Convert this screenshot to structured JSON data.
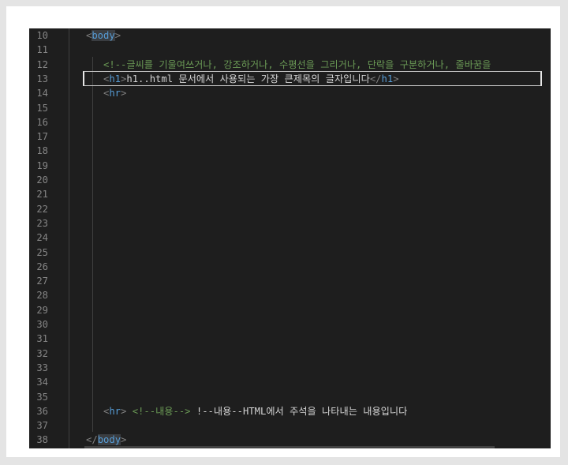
{
  "editor": {
    "lines": [
      {
        "num": "10",
        "tokens": [
          {
            "t": "<",
            "c": "punct"
          },
          {
            "t": "body",
            "c": "tag-hl"
          },
          {
            "t": ">",
            "c": "punct"
          }
        ],
        "indent": 1
      },
      {
        "num": "11",
        "tokens": [],
        "indent": 0
      },
      {
        "num": "12",
        "tokens": [
          {
            "t": "<!--글씨를 기울여쓰거나, 강조하거나, 수평선을 그리거나, 단락을 구분하거나, 줄바꿈을",
            "c": "comment"
          }
        ],
        "indent": 2
      },
      {
        "num": "13",
        "tokens": [
          {
            "t": "<",
            "c": "punct"
          },
          {
            "t": "h1",
            "c": "tag"
          },
          {
            "t": ">",
            "c": "punct"
          },
          {
            "t": "h1..html 문서에서 사용되는 가장 큰제목의 글자입니다",
            "c": "text"
          },
          {
            "t": "</",
            "c": "punct"
          },
          {
            "t": "h1",
            "c": "tag"
          },
          {
            "t": ">",
            "c": "punct"
          }
        ],
        "indent": 2,
        "current": true
      },
      {
        "num": "14",
        "tokens": [
          {
            "t": "<",
            "c": "punct"
          },
          {
            "t": "hr",
            "c": "tag"
          },
          {
            "t": ">",
            "c": "punct"
          }
        ],
        "indent": 2
      },
      {
        "num": "15",
        "tokens": [],
        "indent": 0
      },
      {
        "num": "16",
        "tokens": [],
        "indent": 0
      },
      {
        "num": "17",
        "tokens": [],
        "indent": 0
      },
      {
        "num": "18",
        "tokens": [],
        "indent": 0
      },
      {
        "num": "19",
        "tokens": [],
        "indent": 0
      },
      {
        "num": "20",
        "tokens": [],
        "indent": 0
      },
      {
        "num": "21",
        "tokens": [],
        "indent": 0
      },
      {
        "num": "22",
        "tokens": [],
        "indent": 0
      },
      {
        "num": "23",
        "tokens": [],
        "indent": 0
      },
      {
        "num": "24",
        "tokens": [],
        "indent": 0
      },
      {
        "num": "25",
        "tokens": [],
        "indent": 0
      },
      {
        "num": "26",
        "tokens": [],
        "indent": 0
      },
      {
        "num": "27",
        "tokens": [],
        "indent": 0
      },
      {
        "num": "28",
        "tokens": [],
        "indent": 0
      },
      {
        "num": "29",
        "tokens": [],
        "indent": 0
      },
      {
        "num": "30",
        "tokens": [],
        "indent": 0
      },
      {
        "num": "31",
        "tokens": [],
        "indent": 0
      },
      {
        "num": "32",
        "tokens": [],
        "indent": 0
      },
      {
        "num": "33",
        "tokens": [],
        "indent": 0
      },
      {
        "num": "34",
        "tokens": [],
        "indent": 0
      },
      {
        "num": "35",
        "tokens": [],
        "indent": 0
      },
      {
        "num": "36",
        "tokens": [
          {
            "t": "<",
            "c": "punct"
          },
          {
            "t": "hr",
            "c": "tag"
          },
          {
            "t": "> ",
            "c": "punct"
          },
          {
            "t": "<!--내용-->",
            "c": "comment"
          },
          {
            "t": " !--내용--HTML에서 주석을 나타내는 내용입니다",
            "c": "text"
          }
        ],
        "indent": 2
      },
      {
        "num": "37",
        "tokens": [],
        "indent": 0
      },
      {
        "num": "38",
        "tokens": [
          {
            "t": "</",
            "c": "punct"
          },
          {
            "t": "body",
            "c": "tag-hl"
          },
          {
            "t": ">",
            "c": "punct"
          }
        ],
        "indent": 1
      }
    ]
  },
  "colors": {
    "background": "#1e1e1e",
    "line_number": "#858585",
    "tag": "#569cd6",
    "comment": "#6a9955",
    "text": "#d4d4d4",
    "punctuation": "#808080"
  }
}
